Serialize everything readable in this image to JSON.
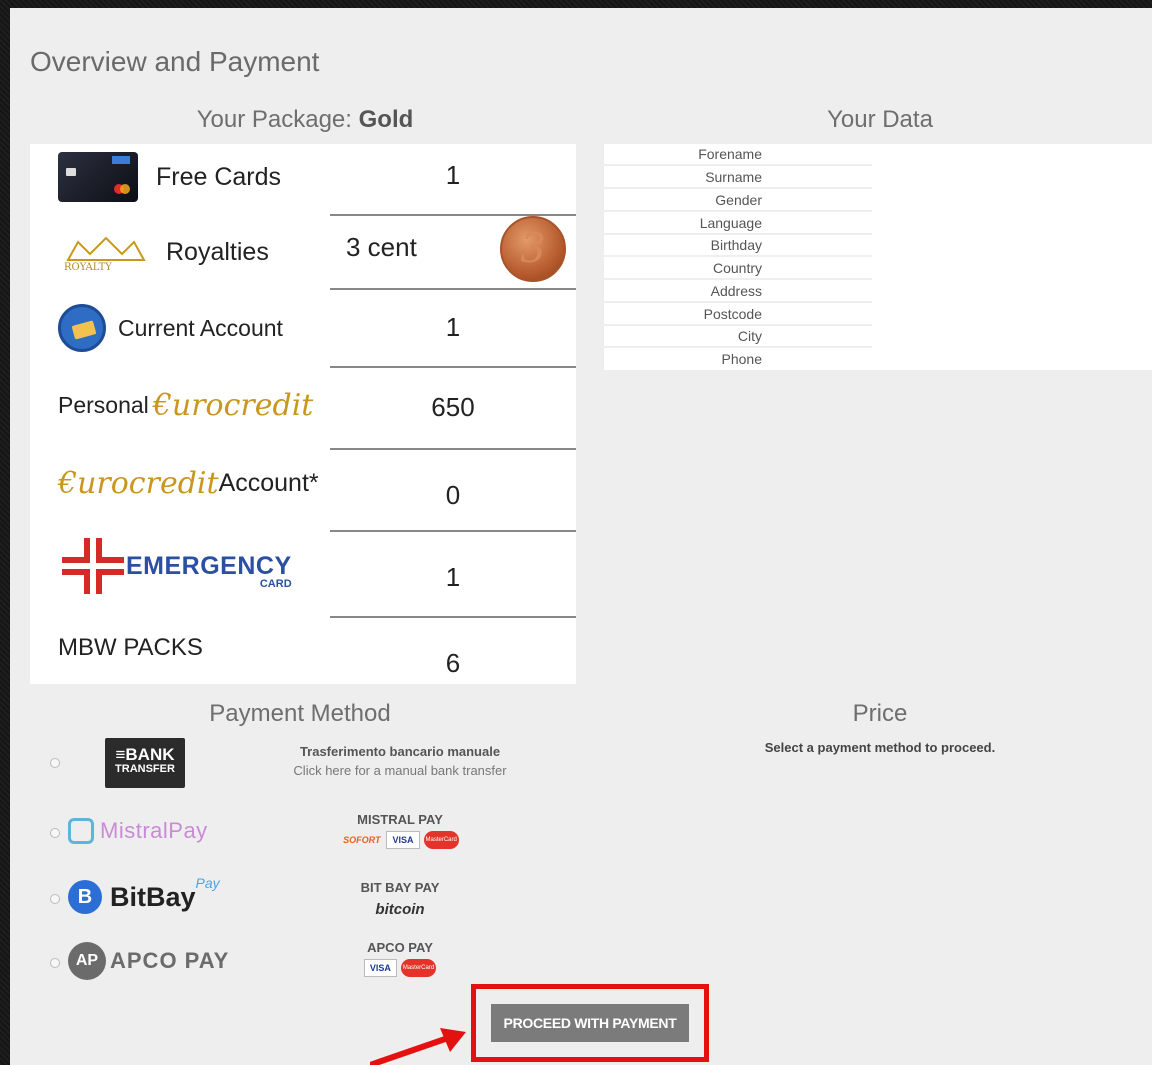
{
  "page_title": "Overview and Payment",
  "package": {
    "heading_prefix": "Your Package: ",
    "heading_name": "Gold",
    "rows": [
      {
        "label": "Free Cards",
        "value": "1"
      },
      {
        "label": "Royalties",
        "value": "3 cent",
        "coin": "3"
      },
      {
        "label": "Current Account",
        "value": "1"
      },
      {
        "label_prefix": "Personal",
        "label_brand": "€urocredit",
        "value": "650"
      },
      {
        "label_brand": "€urocredit",
        "label_suffix": "Account*",
        "value": "0"
      },
      {
        "label": "EMERGENCY",
        "label_sub": "CARD",
        "value": "1"
      },
      {
        "label": "MBW PACKS",
        "value": "6"
      }
    ],
    "royalty_logo_text": "ROYALTY"
  },
  "your_data": {
    "heading": "Your Data",
    "fields": [
      "Forename",
      "Surname",
      "Gender",
      "Language",
      "Birthday",
      "Country",
      "Address",
      "Postcode",
      "City",
      "Phone"
    ]
  },
  "payment": {
    "heading": "Payment Method",
    "methods": [
      {
        "logo_line1": "≡BANK",
        "logo_line2": "TRANSFER",
        "title": "Trasferimento bancario manuale",
        "subtitle": "Click here for a manual bank transfer"
      },
      {
        "logo": "MistralPay",
        "title": "MISTRAL PAY",
        "badges": [
          "SOFORT",
          "VISA",
          "MasterCard"
        ]
      },
      {
        "logo": "BitBay",
        "logo_sup": "Pay",
        "title": "BIT BAY PAY",
        "badge": "bitcoin"
      },
      {
        "logo": "APCO PAY",
        "logo_icon": "AP",
        "title": "APCO PAY",
        "badges": [
          "VISA",
          "MasterCard"
        ]
      }
    ]
  },
  "price": {
    "heading": "Price",
    "note": "Select a payment method to proceed."
  },
  "proceed_button": "PROCEED WITH PAYMENT",
  "colors": {
    "panel_bg": "#eeeeee",
    "eurocredit_gold": "#c9971e",
    "emergency_red": "#d42a2a",
    "emergency_blue": "#2a4fa3",
    "button_bg": "#7b7b7b",
    "highlight_red": "#e3110f",
    "bitbay_blue": "#2b6fd6"
  }
}
